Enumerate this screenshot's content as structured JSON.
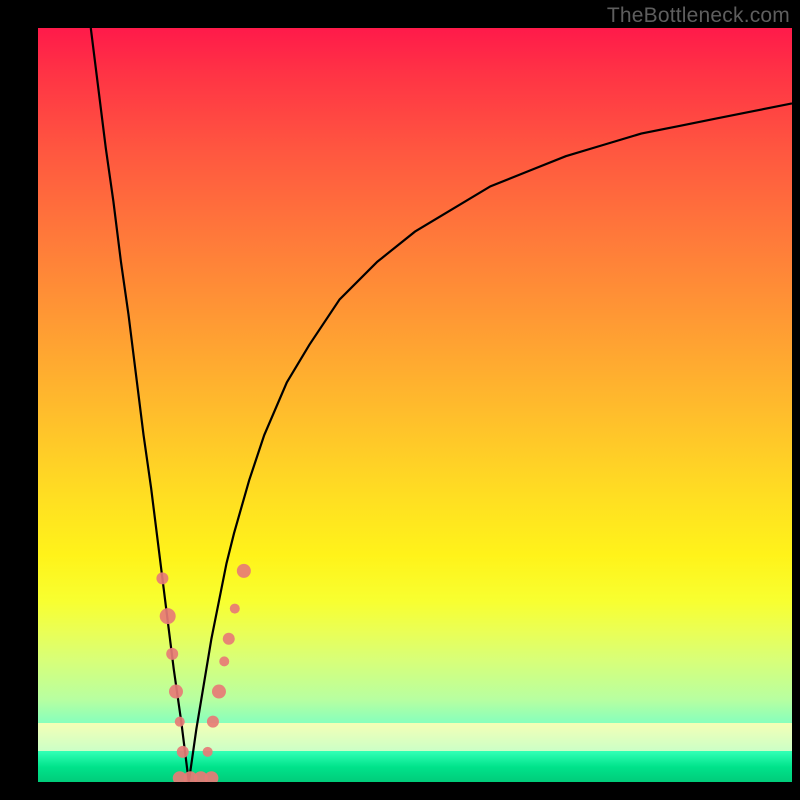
{
  "watermark": "TheBottleneck.com",
  "colors": {
    "curve": "#000000",
    "marker_fill": "#e77b76",
    "marker_stroke": "#c55a55",
    "gradient_top": "#ff1a4a",
    "gradient_bottom": "#00cc7a"
  },
  "chart_data": {
    "type": "line",
    "title": "",
    "xlabel": "",
    "ylabel": "",
    "xlim": [
      0,
      100
    ],
    "ylim": [
      0,
      100
    ],
    "grid": false,
    "x_minimum": 20,
    "series": [
      {
        "name": "curve",
        "x": [
          7,
          8,
          9,
          10,
          11,
          12,
          13,
          14,
          15,
          16,
          17,
          18,
          19,
          20,
          21,
          22,
          23,
          24,
          25,
          26,
          28,
          30,
          33,
          36,
          40,
          45,
          50,
          55,
          60,
          65,
          70,
          75,
          80,
          85,
          90,
          95,
          100
        ],
        "y": [
          100,
          92,
          84,
          77,
          69,
          62,
          54,
          46,
          39,
          31,
          23,
          15,
          8,
          0,
          7,
          13,
          19,
          24,
          29,
          33,
          40,
          46,
          53,
          58,
          64,
          69,
          73,
          76,
          79,
          81,
          83,
          84.5,
          86,
          87,
          88,
          89,
          90
        ]
      }
    ],
    "markers": [
      {
        "x": 16.5,
        "y": 27,
        "r": 6
      },
      {
        "x": 17.2,
        "y": 22,
        "r": 8
      },
      {
        "x": 17.8,
        "y": 17,
        "r": 6
      },
      {
        "x": 18.3,
        "y": 12,
        "r": 7
      },
      {
        "x": 18.8,
        "y": 8,
        "r": 5
      },
      {
        "x": 19.2,
        "y": 4,
        "r": 6
      },
      {
        "x": 18.8,
        "y": 0.5,
        "r": 7
      },
      {
        "x": 20.2,
        "y": 0.5,
        "r": 7
      },
      {
        "x": 21.6,
        "y": 0.5,
        "r": 7
      },
      {
        "x": 23.0,
        "y": 0.5,
        "r": 7
      },
      {
        "x": 22.5,
        "y": 4,
        "r": 5
      },
      {
        "x": 23.2,
        "y": 8,
        "r": 6
      },
      {
        "x": 24.0,
        "y": 12,
        "r": 7
      },
      {
        "x": 24.7,
        "y": 16,
        "r": 5
      },
      {
        "x": 25.3,
        "y": 19,
        "r": 6
      },
      {
        "x": 26.1,
        "y": 23,
        "r": 5
      },
      {
        "x": 27.3,
        "y": 28,
        "r": 7
      }
    ]
  }
}
